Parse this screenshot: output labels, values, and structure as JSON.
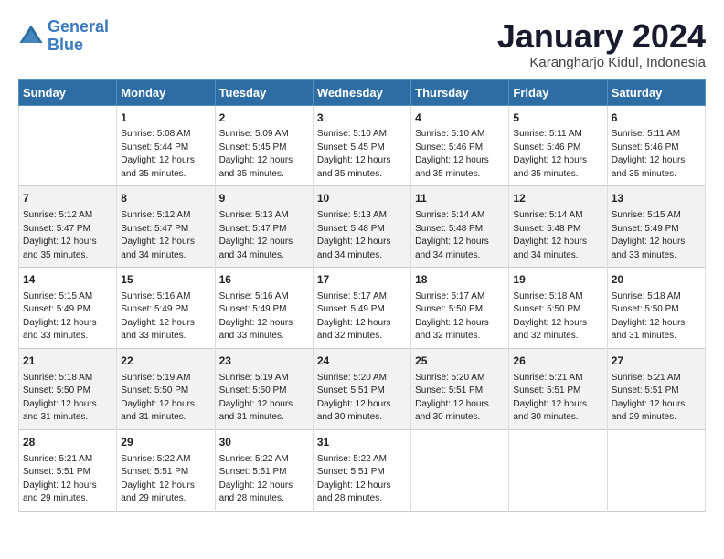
{
  "logo": {
    "line1": "General",
    "line2": "Blue"
  },
  "title": "January 2024",
  "subtitle": "Karangharjo Kidul, Indonesia",
  "days_header": [
    "Sunday",
    "Monday",
    "Tuesday",
    "Wednesday",
    "Thursday",
    "Friday",
    "Saturday"
  ],
  "weeks": [
    [
      {
        "num": "",
        "text": ""
      },
      {
        "num": "1",
        "text": "Sunrise: 5:08 AM\nSunset: 5:44 PM\nDaylight: 12 hours\nand 35 minutes."
      },
      {
        "num": "2",
        "text": "Sunrise: 5:09 AM\nSunset: 5:45 PM\nDaylight: 12 hours\nand 35 minutes."
      },
      {
        "num": "3",
        "text": "Sunrise: 5:10 AM\nSunset: 5:45 PM\nDaylight: 12 hours\nand 35 minutes."
      },
      {
        "num": "4",
        "text": "Sunrise: 5:10 AM\nSunset: 5:46 PM\nDaylight: 12 hours\nand 35 minutes."
      },
      {
        "num": "5",
        "text": "Sunrise: 5:11 AM\nSunset: 5:46 PM\nDaylight: 12 hours\nand 35 minutes."
      },
      {
        "num": "6",
        "text": "Sunrise: 5:11 AM\nSunset: 5:46 PM\nDaylight: 12 hours\nand 35 minutes."
      }
    ],
    [
      {
        "num": "7",
        "text": "Sunrise: 5:12 AM\nSunset: 5:47 PM\nDaylight: 12 hours\nand 35 minutes."
      },
      {
        "num": "8",
        "text": "Sunrise: 5:12 AM\nSunset: 5:47 PM\nDaylight: 12 hours\nand 34 minutes."
      },
      {
        "num": "9",
        "text": "Sunrise: 5:13 AM\nSunset: 5:47 PM\nDaylight: 12 hours\nand 34 minutes."
      },
      {
        "num": "10",
        "text": "Sunrise: 5:13 AM\nSunset: 5:48 PM\nDaylight: 12 hours\nand 34 minutes."
      },
      {
        "num": "11",
        "text": "Sunrise: 5:14 AM\nSunset: 5:48 PM\nDaylight: 12 hours\nand 34 minutes."
      },
      {
        "num": "12",
        "text": "Sunrise: 5:14 AM\nSunset: 5:48 PM\nDaylight: 12 hours\nand 34 minutes."
      },
      {
        "num": "13",
        "text": "Sunrise: 5:15 AM\nSunset: 5:49 PM\nDaylight: 12 hours\nand 33 minutes."
      }
    ],
    [
      {
        "num": "14",
        "text": "Sunrise: 5:15 AM\nSunset: 5:49 PM\nDaylight: 12 hours\nand 33 minutes."
      },
      {
        "num": "15",
        "text": "Sunrise: 5:16 AM\nSunset: 5:49 PM\nDaylight: 12 hours\nand 33 minutes."
      },
      {
        "num": "16",
        "text": "Sunrise: 5:16 AM\nSunset: 5:49 PM\nDaylight: 12 hours\nand 33 minutes."
      },
      {
        "num": "17",
        "text": "Sunrise: 5:17 AM\nSunset: 5:49 PM\nDaylight: 12 hours\nand 32 minutes."
      },
      {
        "num": "18",
        "text": "Sunrise: 5:17 AM\nSunset: 5:50 PM\nDaylight: 12 hours\nand 32 minutes."
      },
      {
        "num": "19",
        "text": "Sunrise: 5:18 AM\nSunset: 5:50 PM\nDaylight: 12 hours\nand 32 minutes."
      },
      {
        "num": "20",
        "text": "Sunrise: 5:18 AM\nSunset: 5:50 PM\nDaylight: 12 hours\nand 31 minutes."
      }
    ],
    [
      {
        "num": "21",
        "text": "Sunrise: 5:18 AM\nSunset: 5:50 PM\nDaylight: 12 hours\nand 31 minutes."
      },
      {
        "num": "22",
        "text": "Sunrise: 5:19 AM\nSunset: 5:50 PM\nDaylight: 12 hours\nand 31 minutes."
      },
      {
        "num": "23",
        "text": "Sunrise: 5:19 AM\nSunset: 5:50 PM\nDaylight: 12 hours\nand 31 minutes."
      },
      {
        "num": "24",
        "text": "Sunrise: 5:20 AM\nSunset: 5:51 PM\nDaylight: 12 hours\nand 30 minutes."
      },
      {
        "num": "25",
        "text": "Sunrise: 5:20 AM\nSunset: 5:51 PM\nDaylight: 12 hours\nand 30 minutes."
      },
      {
        "num": "26",
        "text": "Sunrise: 5:21 AM\nSunset: 5:51 PM\nDaylight: 12 hours\nand 30 minutes."
      },
      {
        "num": "27",
        "text": "Sunrise: 5:21 AM\nSunset: 5:51 PM\nDaylight: 12 hours\nand 29 minutes."
      }
    ],
    [
      {
        "num": "28",
        "text": "Sunrise: 5:21 AM\nSunset: 5:51 PM\nDaylight: 12 hours\nand 29 minutes."
      },
      {
        "num": "29",
        "text": "Sunrise: 5:22 AM\nSunset: 5:51 PM\nDaylight: 12 hours\nand 29 minutes."
      },
      {
        "num": "30",
        "text": "Sunrise: 5:22 AM\nSunset: 5:51 PM\nDaylight: 12 hours\nand 28 minutes."
      },
      {
        "num": "31",
        "text": "Sunrise: 5:22 AM\nSunset: 5:51 PM\nDaylight: 12 hours\nand 28 minutes."
      },
      {
        "num": "",
        "text": ""
      },
      {
        "num": "",
        "text": ""
      },
      {
        "num": "",
        "text": ""
      }
    ]
  ]
}
